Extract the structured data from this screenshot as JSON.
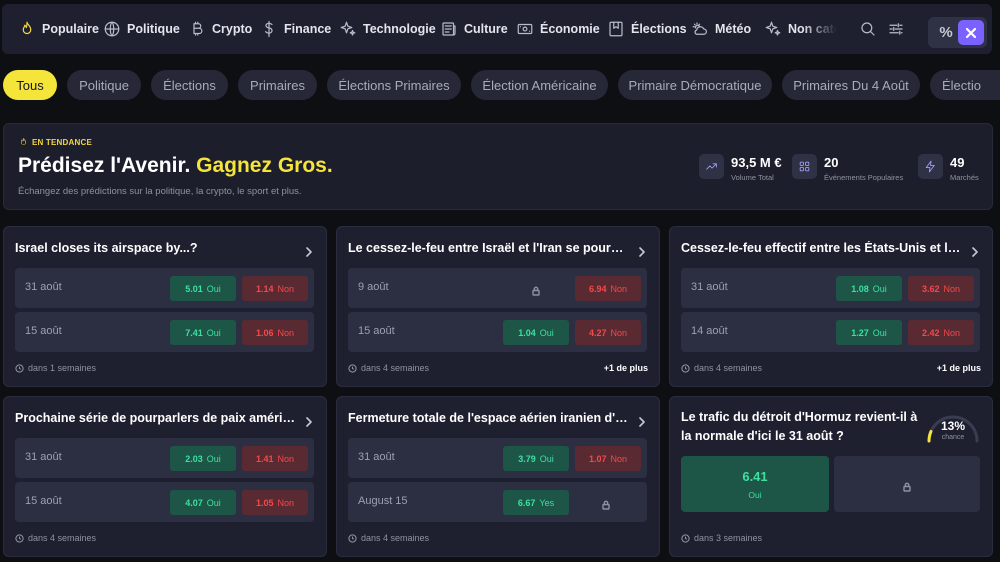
{
  "categories": [
    {
      "label": "Populaire",
      "icon": "flame-icon",
      "active": true
    },
    {
      "label": "Politique",
      "icon": "globe-icon"
    },
    {
      "label": "Crypto",
      "icon": "bitcoin-icon"
    },
    {
      "label": "Finance",
      "icon": "dollar-icon"
    },
    {
      "label": "Technologie",
      "icon": "sparkles-icon"
    },
    {
      "label": "Culture",
      "icon": "newspaper-icon"
    },
    {
      "label": "Économie",
      "icon": "banknote-icon"
    },
    {
      "label": "Élections",
      "icon": "ballot-icon"
    },
    {
      "label": "Météo",
      "icon": "cloud-sun-icon"
    },
    {
      "label": "Non catég",
      "icon": "sparkles-icon"
    }
  ],
  "toolbar": {
    "pct_label": "%"
  },
  "tags": [
    "Tous",
    "Politique",
    "Élections",
    "Primaires",
    "Élections Primaires",
    "Élection Américaine",
    "Primaire Démocratique",
    "Primaires Du 4 Août",
    "Électio"
  ],
  "hero": {
    "badge": "EN TENDANCE",
    "title": "Prédisez l'Avenir.",
    "title_accent": "Gagnez Gros.",
    "subtitle": "Échangez des prédictions sur la politique, la crypto, le sport et plus.",
    "stats": [
      {
        "value": "93,5 M €",
        "label": "Volume Total",
        "icon": "trending-up-icon"
      },
      {
        "value": "20",
        "label": "Événements Populaires",
        "icon": "grid-icon"
      },
      {
        "value": "49",
        "label": "Marchés",
        "icon": "bolt-icon"
      }
    ]
  },
  "markets": [
    {
      "title": "Israel closes its airspace by...?",
      "foot": "dans 1 semaines",
      "more": "",
      "rows": [
        {
          "date": "31 août",
          "yes": "5.01",
          "yes_word": "Oui",
          "no": "1.14",
          "no_word": "Non"
        },
        {
          "date": "15 août",
          "yes": "7.41",
          "yes_word": "Oui",
          "no": "1.06",
          "no_word": "Non"
        }
      ]
    },
    {
      "title": "Le cessez-le-feu entre Israël et l'Iran se poursuit...",
      "foot": "dans 4 semaines",
      "more": "+1 de plus",
      "rows": [
        {
          "date": "9 août",
          "locked": true,
          "no": "6.94",
          "no_word": "Non"
        },
        {
          "date": "15 août",
          "yes": "1.04",
          "yes_word": "Oui",
          "no": "4.27",
          "no_word": "Non"
        }
      ]
    },
    {
      "title": "Cessez-le-feu effectif entre les États-Unis et l'Iran...",
      "foot": "dans 4 semaines",
      "more": "+1 de plus",
      "rows": [
        {
          "date": "31 août",
          "yes": "1.08",
          "yes_word": "Oui",
          "no": "3.62",
          "no_word": "Non"
        },
        {
          "date": "14 août",
          "yes": "1.27",
          "yes_word": "Oui",
          "no": "2.42",
          "no_word": "Non"
        }
      ]
    },
    {
      "title": "Prochaine série de pourparlers de paix américano-...",
      "foot": "dans 4 semaines",
      "more": "",
      "rows": [
        {
          "date": "31 août",
          "yes": "2.03",
          "yes_word": "Oui",
          "no": "1.41",
          "no_word": "Non"
        },
        {
          "date": "15 août",
          "yes": "4.07",
          "yes_word": "Oui",
          "no": "1.05",
          "no_word": "Non"
        }
      ]
    },
    {
      "title": "Fermeture totale de l'espace aérien iranien d'ici ...",
      "foot": "dans 4 semaines",
      "more": "",
      "rows": [
        {
          "date": "31 août",
          "yes": "3.79",
          "yes_word": "Oui",
          "no": "1.07",
          "no_word": "Non"
        },
        {
          "date": "August 15",
          "yes": "6.67",
          "yes_word": "Yes",
          "locked_no": true
        }
      ]
    }
  ],
  "featured": {
    "title": "Le trafic du détroit d'Hormuz revient-il à la normale d'ici le 31 août ?",
    "chance_value": 13,
    "chance_text": "13%",
    "chance_label": "chance",
    "yes_value": "6.41",
    "yes_label": "Oui",
    "foot": "dans 3 semaines"
  },
  "colors": {
    "accent": "#f5e43a",
    "brand": "#7b61ff",
    "yes": "#3ee0a0",
    "no": "#f04a4a"
  }
}
